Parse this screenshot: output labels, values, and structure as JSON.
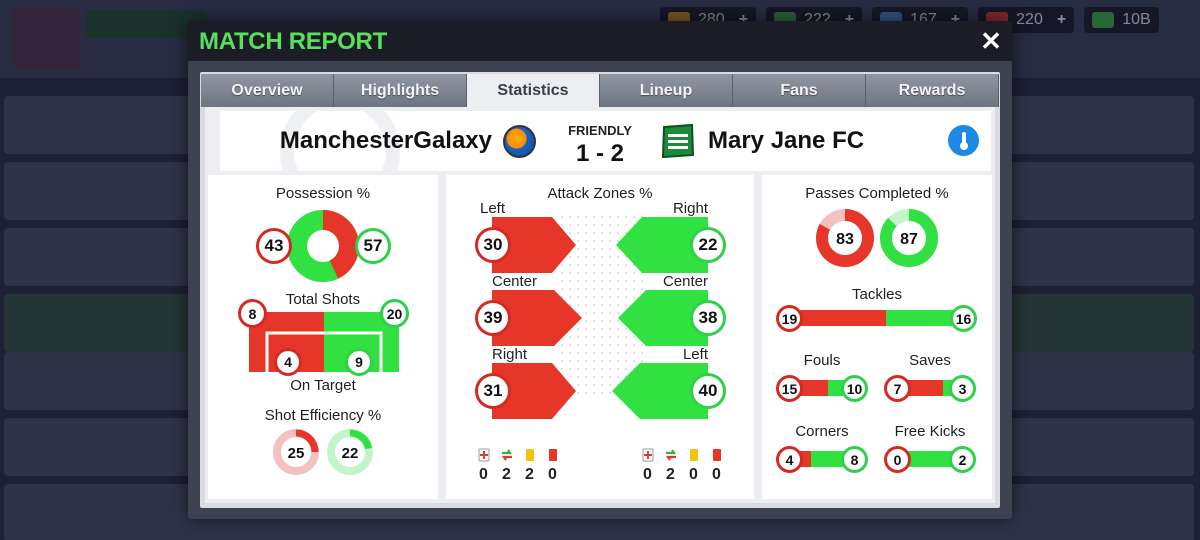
{
  "background": {
    "resources": [
      {
        "icon": "coin-icon",
        "value": "280"
      },
      {
        "icon": "cash-icon",
        "value": "222"
      },
      {
        "icon": "energy-icon",
        "value": "167"
      },
      {
        "icon": "medical-icon",
        "value": "220"
      },
      {
        "icon": "money-icon",
        "value": "10B"
      }
    ]
  },
  "modal": {
    "title": "MATCH REPORT",
    "close_label": "✕"
  },
  "tabs": [
    "Overview",
    "Highlights",
    "Statistics",
    "Lineup",
    "Fans",
    "Rewards"
  ],
  "active_tab": "Statistics",
  "match": {
    "home_team": "ManchesterGalaxy",
    "away_team": "Mary Jane FC",
    "type": "FRIENDLY",
    "score": "1 - 2",
    "home_color": "#e53629",
    "away_color": "#31e041"
  },
  "possession": {
    "label": "Possession %",
    "home": 43,
    "away": 57
  },
  "shots": {
    "label": "Total Shots",
    "home_total": 8,
    "away_total": 20,
    "on_target_label": "On Target",
    "home_on_target": 4,
    "away_on_target": 9
  },
  "shot_efficiency": {
    "label": "Shot Efficiency %",
    "home": 25,
    "away": 22
  },
  "attack_zones": {
    "label": "Attack Zones %",
    "rows": [
      {
        "home_label": "Left",
        "home": 30,
        "away_label": "Right",
        "away": 22
      },
      {
        "home_label": "Center",
        "home": 39,
        "away_label": "Center",
        "away": 38
      },
      {
        "home_label": "Right",
        "home": 31,
        "away_label": "Left",
        "away": 40
      }
    ]
  },
  "discipline": {
    "icons": [
      "injury-icon",
      "substitution-icon",
      "yellow-card-icon",
      "red-card-icon"
    ],
    "home": [
      "0",
      "2",
      "2",
      "0"
    ],
    "away": [
      "0",
      "2",
      "0",
      "0"
    ]
  },
  "passes": {
    "label": "Passes Completed %",
    "home": 83,
    "away": 87
  },
  "tackles": {
    "label": "Tackles",
    "home": 19,
    "away": 16
  },
  "fouls": {
    "label": "Fouls",
    "home": 15,
    "away": 10
  },
  "saves": {
    "label": "Saves",
    "home": 7,
    "away": 3
  },
  "corners": {
    "label": "Corners",
    "home": 4,
    "away": 8
  },
  "free_kicks": {
    "label": "Free Kicks",
    "home": 0,
    "away": 2
  }
}
